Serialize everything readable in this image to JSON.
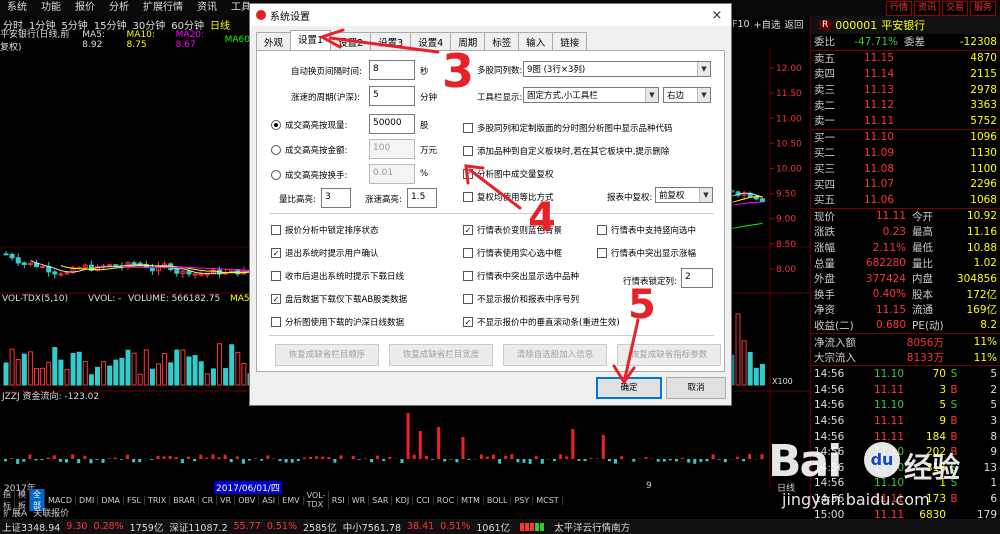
{
  "menubar": {
    "items": [
      "系统",
      "功能",
      "报价",
      "分析",
      "扩展行情",
      "资讯",
      "工具"
    ],
    "right_buttons": [
      "行情",
      "资讯",
      "交易",
      "服务"
    ],
    "right_extra": [
      "F10",
      "+自选",
      "返回"
    ]
  },
  "period": {
    "items": [
      "分时",
      "1分钟",
      "5分钟",
      "15分钟",
      "30分钟",
      "60分钟",
      "日线"
    ]
  },
  "chart_title": {
    "name": "平安银行(日线,前复权)",
    "ma5": "MA5: 8.92",
    "ma10": "MA10: 8.75",
    "ma20": "MA20: 8.67",
    "ma60": "MA60"
  },
  "chart_data": [
    {
      "type": "candlestick",
      "title": "平安银行(日线,前复权)",
      "y_ticks": [
        "12.00",
        "11.50",
        "11.00",
        "10.50",
        "10.00",
        "9.50",
        "9.00",
        "8.50",
        "8.00"
      ],
      "ylim": [
        7.6,
        12.3
      ]
    },
    {
      "type": "bar",
      "title": "VOL-TDX(5,10)",
      "labels": {
        "vvol": "VVOL: -",
        "volume": "VOLUME: 566182.75",
        "ma5": "MA5: 929735.94"
      },
      "y_ticks": [
        "X100"
      ]
    },
    {
      "type": "bar",
      "title": "JZZJ 资金流向: -123.02"
    }
  ],
  "right_axis": {
    "ticks": [
      "12.00",
      "11.50",
      "11.00",
      "10.50",
      "10.00",
      "9.50",
      "9.00",
      "8.50",
      "8.00"
    ],
    "vol_ticks": [
      "X100"
    ]
  },
  "date_bar": {
    "year": "2017年",
    "date": "2017/06/01/四",
    "m9": "9",
    "day": "日线"
  },
  "stock": {
    "code": "000001",
    "name": "平安银行",
    "badge": "R",
    "weibi_label": "委比",
    "weibi_val": "-47.71%",
    "weicha_label": "委差",
    "weicha_val": "-12308",
    "asks": [
      {
        "l": "卖五",
        "p": "11.15",
        "q": "4870"
      },
      {
        "l": "卖四",
        "p": "11.14",
        "q": "2115"
      },
      {
        "l": "卖三",
        "p": "11.13",
        "q": "2978"
      },
      {
        "l": "卖二",
        "p": "11.12",
        "q": "3363"
      },
      {
        "l": "卖一",
        "p": "11.11",
        "q": "5752"
      }
    ],
    "bids": [
      {
        "l": "买一",
        "p": "11.10",
        "q": "1096"
      },
      {
        "l": "买二",
        "p": "11.09",
        "q": "1130"
      },
      {
        "l": "买三",
        "p": "11.08",
        "q": "1100"
      },
      {
        "l": "买四",
        "p": "11.07",
        "q": "2296"
      },
      {
        "l": "买五",
        "p": "11.06",
        "q": "1068"
      }
    ],
    "stats": [
      {
        "a": "现价",
        "b": "11.11",
        "c": "今开",
        "d": "10.92"
      },
      {
        "a": "涨跌",
        "b": "0.23",
        "c": "最高",
        "d": "11.16"
      },
      {
        "a": "涨幅",
        "b": "2.11%",
        "c": "最低",
        "d": "10.88"
      },
      {
        "a": "总量",
        "b": "682280",
        "c": "量比",
        "d": "1.02"
      },
      {
        "a": "外盘",
        "b": "377424",
        "c": "内盘",
        "d": "304856"
      },
      {
        "a": "换手",
        "b": "0.40%",
        "c": "股本",
        "d": "172亿"
      },
      {
        "a": "净资",
        "b": "11.15",
        "c": "流通",
        "d": "169亿"
      },
      {
        "a": "收益(二)",
        "b": "0.680",
        "c": "PE(动)",
        "d": "8.2"
      }
    ],
    "flows": [
      {
        "a": "净流入额",
        "b": "8056万",
        "c": "11%"
      },
      {
        "a": "大宗流入",
        "b": "8133万",
        "c": "11%"
      }
    ],
    "ticks": [
      {
        "t": "14:56",
        "p": "11.10",
        "v": "70",
        "s": "S",
        "n": "5"
      },
      {
        "t": "14:56",
        "p": "11.11",
        "v": "3",
        "s": "B",
        "n": "2"
      },
      {
        "t": "14:56",
        "p": "11.10",
        "v": "5",
        "s": "S",
        "n": "5"
      },
      {
        "t": "14:56",
        "p": "11.11",
        "v": "9",
        "s": "B",
        "n": "3"
      },
      {
        "t": "14:56",
        "p": "11.11",
        "v": "184",
        "s": "B",
        "n": "8"
      },
      {
        "t": "14:56",
        "p": "11.10",
        "v": "202",
        "s": "B",
        "n": "9"
      },
      {
        "t": "14:56",
        "p": "11.10",
        "v": "316",
        "s": "S",
        "n": "13"
      },
      {
        "t": "14:56",
        "p": "11.10",
        "v": "1",
        "s": "S",
        "n": "1"
      },
      {
        "t": "14:56",
        "p": "11.11",
        "v": "173",
        "s": "B",
        "n": "6"
      },
      {
        "t": "15:00",
        "p": "11.11",
        "v": "6830",
        "s": "",
        "n": "179"
      }
    ]
  },
  "indicators": [
    "指标",
    "模板",
    "全部",
    "MACD",
    "DMI",
    "DMA",
    "FSL",
    "TRIX",
    "BRAR",
    "CR",
    "VR",
    "OBV",
    "ASI",
    "EMV",
    "VOL-TDX",
    "RSI",
    "WR",
    "SAR",
    "KDJ",
    "CCI",
    "ROC",
    "MTM",
    "BOLL",
    "PSY",
    "MCST"
  ],
  "tabs2": [
    "扩展A",
    "关联报价"
  ],
  "statusbar": {
    "sh": "上证3348.94",
    "sh_c": "9.30",
    "sh_p": "0.28%",
    "sh_v": "1759亿",
    "sz": "深证11087.2",
    "sz_c": "55.77",
    "sz_p": "0.51%",
    "sz_v": "2585亿",
    "zx": "中小7561.78",
    "zx_c": "38.41",
    "zx_p": "0.51%",
    "zx_v": "1061亿",
    "news": "太平洋云行情南方"
  },
  "dialog": {
    "title": "系统设置",
    "close": "×",
    "tabs": [
      "外观",
      "设置1",
      "设置2",
      "设置3",
      "设置4",
      "周期",
      "标签",
      "输入",
      "链接"
    ],
    "auto_page_label": "自动换页间隔时间:",
    "auto_page_value": "8",
    "auto_page_unit": "秒",
    "period_label": "涨速的周期(沪深):",
    "period_value": "5",
    "period_unit": "分钟",
    "multi_col_label": "多股同列数:",
    "multi_col_value": "9图 (3行×3列)",
    "toolbar_label": "工具栏显示:",
    "toolbar_value": "固定方式,小工具栏",
    "toolbar_pos": "右边",
    "radio1": "成交高亮按现量:",
    "radio1_val": "50000",
    "radio1_unit": "股",
    "radio2": "成交高亮按金额:",
    "radio2_val": "100",
    "radio2_unit": "万元",
    "radio3": "成交高亮按换手:",
    "radio3_val": "0.01",
    "radio3_unit": "%",
    "vol_ratio_label": "量比高亮:",
    "vol_ratio_val": "3",
    "speed_label": "涨速高亮:",
    "speed_val": "1.5",
    "cb_multi": "多股同列和定制版面的分时图分析图中显示品种代码",
    "cb_add": "添加品种到自定义板块时,若在其它板块中,提示删除",
    "cb_vol_fq": "分析图中成交量复权",
    "cb_fq_ratio": "复权均使用等比方式",
    "report_fq_label": "报表中复权:",
    "report_fq_value": "前复权",
    "cb_rows": [
      [
        "报价分析中锁定排序状态",
        "行情表价变则蓝色背景",
        "行情表中支持竖向选中"
      ],
      [
        "退出系统时提示用户确认",
        "行情表使用实心选中框",
        "行情表中突出显示涨幅"
      ],
      [
        "收市后退出系统时提示下载日线",
        "行情表中突出显示选中品种",
        ""
      ],
      [
        "盘后数据下载仅下载AB股类数据",
        "不显示报价和报表中序号列",
        ""
      ],
      [
        "分析图使用下载的沪深日线数据",
        "不显示报价中的垂直滚动条(重进生效)",
        ""
      ]
    ],
    "lock_col_label": "行情表锁定列:",
    "lock_col_val": "2",
    "btns": [
      "恢复成缺省栏目顺序",
      "恢复成缺省栏目宽度",
      "清除自选股加入信息",
      "恢复成缺省指标参数"
    ],
    "ok": "确定",
    "cancel": "取消"
  },
  "annotations": [
    "3",
    "4",
    "5"
  ],
  "watermark": {
    "brand": "Bai",
    "paw": "du",
    "suffix": "经验",
    "url": "jingyan.baidu.com"
  }
}
